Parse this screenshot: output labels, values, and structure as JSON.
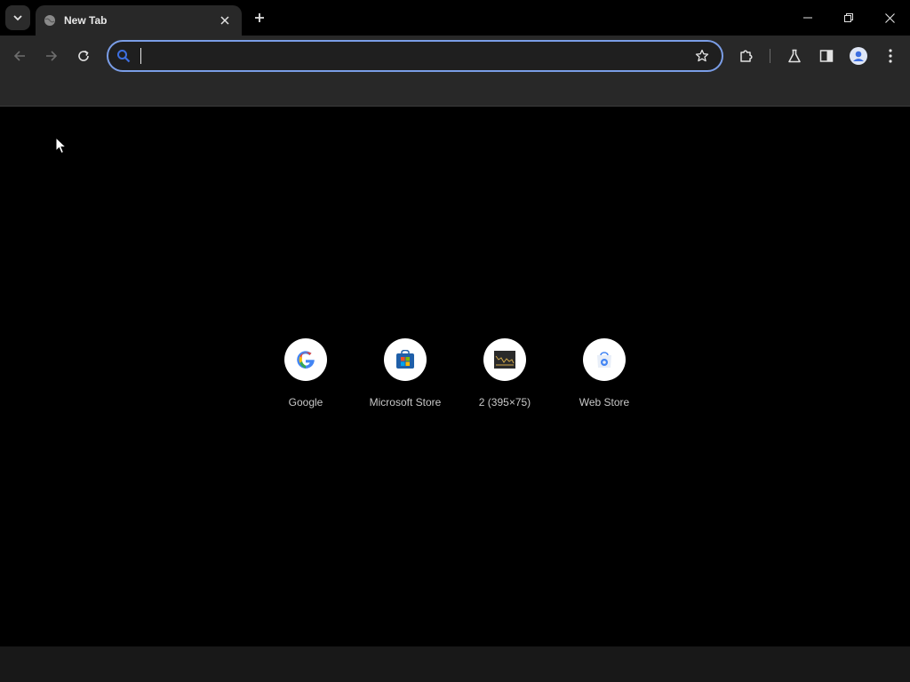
{
  "tab": {
    "title": "New Tab",
    "favicon": "globe-icon"
  },
  "omnibox": {
    "value": "",
    "placeholder": ""
  },
  "shortcuts": [
    {
      "label": "Google",
      "icon": "google-logo-icon"
    },
    {
      "label": "Microsoft Store",
      "icon": "microsoft-store-icon"
    },
    {
      "label": "2 (395×75)",
      "icon": "image-thumbnail-icon"
    },
    {
      "label": "Web Store",
      "icon": "web-store-icon"
    }
  ],
  "colors": {
    "omnibox_focus_ring": "#7a9de6",
    "toolbar_bg": "#282828",
    "page_bg": "#000000"
  }
}
